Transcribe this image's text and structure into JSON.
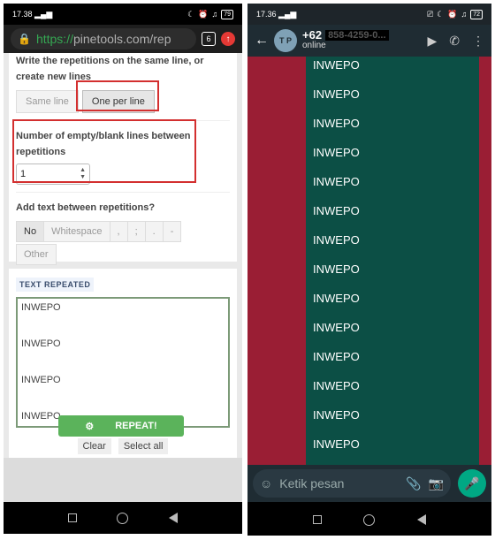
{
  "left": {
    "status": {
      "time": "17.38",
      "net_speed": "0.00 KB/S",
      "battery": "79"
    },
    "browser": {
      "url_protocol": "https://",
      "url_rest": "pinetools.com/rep",
      "tab_count": "6"
    },
    "form": {
      "same_line_label": "Write the repetitions on the same line, or create new lines",
      "line_options": [
        "Same line",
        "One per line"
      ],
      "line_selected": "One per line",
      "blank_lines_label": "Number of empty/blank lines between repetitions",
      "blank_lines_value": "1",
      "add_text_label": "Add text between repetitions?",
      "separators": [
        "No",
        "Whitespace",
        ",",
        ";",
        ".",
        "-"
      ],
      "separator_other": "Other",
      "separator_selected": "No"
    },
    "result": {
      "tag": "TEXT REPEATED",
      "lines": [
        "INWEPO",
        "INWEPO",
        "INWEPO",
        "INWEPO"
      ],
      "clear_label": "Clear",
      "select_all_label": "Select all"
    },
    "repeat_label": "REPEAT!"
  },
  "right": {
    "status": {
      "time": "17.36",
      "net_speed": "0.00 KB/S",
      "battery": "72"
    },
    "header": {
      "name": "+62",
      "redacted_number": "858-4259-0...",
      "status": "online",
      "avatar_text": "T P"
    },
    "messages": [
      "INWEPO",
      "INWEPO",
      "INWEPO",
      "INWEPO",
      "INWEPO",
      "INWEPO",
      "INWEPO",
      "INWEPO",
      "INWEPO",
      "INWEPO",
      "INWEPO",
      "INWEPO",
      "INWEPO",
      "INWEPO"
    ],
    "compose_placeholder": "Ketik pesan"
  },
  "colors": {
    "highlight": "#d32f2f",
    "wa_bubble": "#0c4f45",
    "wa_bg": "#9a1e34",
    "repeat_button": "#5bb35b",
    "send_button": "#00a884"
  }
}
